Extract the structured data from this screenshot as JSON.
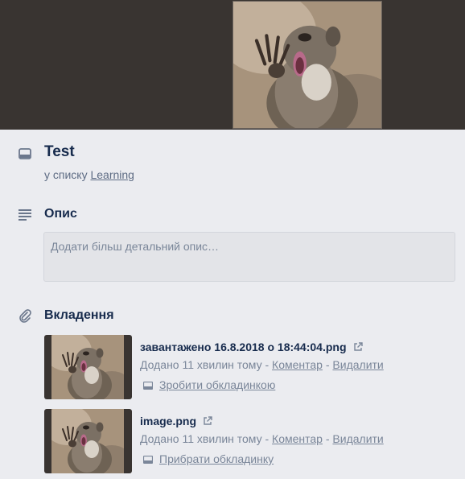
{
  "card": {
    "title": "Test",
    "in_list_prefix": "у списку",
    "list_name": "Learning"
  },
  "icons": {
    "card": "card-icon",
    "description": "description-lines-icon",
    "attachment": "paperclip-icon",
    "external": "external-link-icon",
    "cover": "card-cover-icon"
  },
  "description": {
    "heading": "Опис",
    "placeholder": "Додати більш детальний опис…"
  },
  "attachments": {
    "heading": "Вкладення",
    "items": [
      {
        "name": "завантажено 16.8.2018 о 18:44:04.png",
        "added": "Додано 11 хвилин тому",
        "sep1": "-",
        "comment": "Коментар",
        "sep2": "-",
        "delete": "Видалити",
        "cover_action": "Зробити обкладинкою"
      },
      {
        "name": "image.png",
        "added": "Додано 11 хвилин тому",
        "sep1": "-",
        "comment": "Коментар",
        "sep2": "-",
        "delete": "Видалити",
        "cover_action": "Прибрати обкладинку"
      }
    ]
  },
  "colors": {
    "cover_bg": "#393431",
    "panel_bg": "#ebecf0",
    "text": "#172b4d",
    "muted": "#7a8699"
  }
}
